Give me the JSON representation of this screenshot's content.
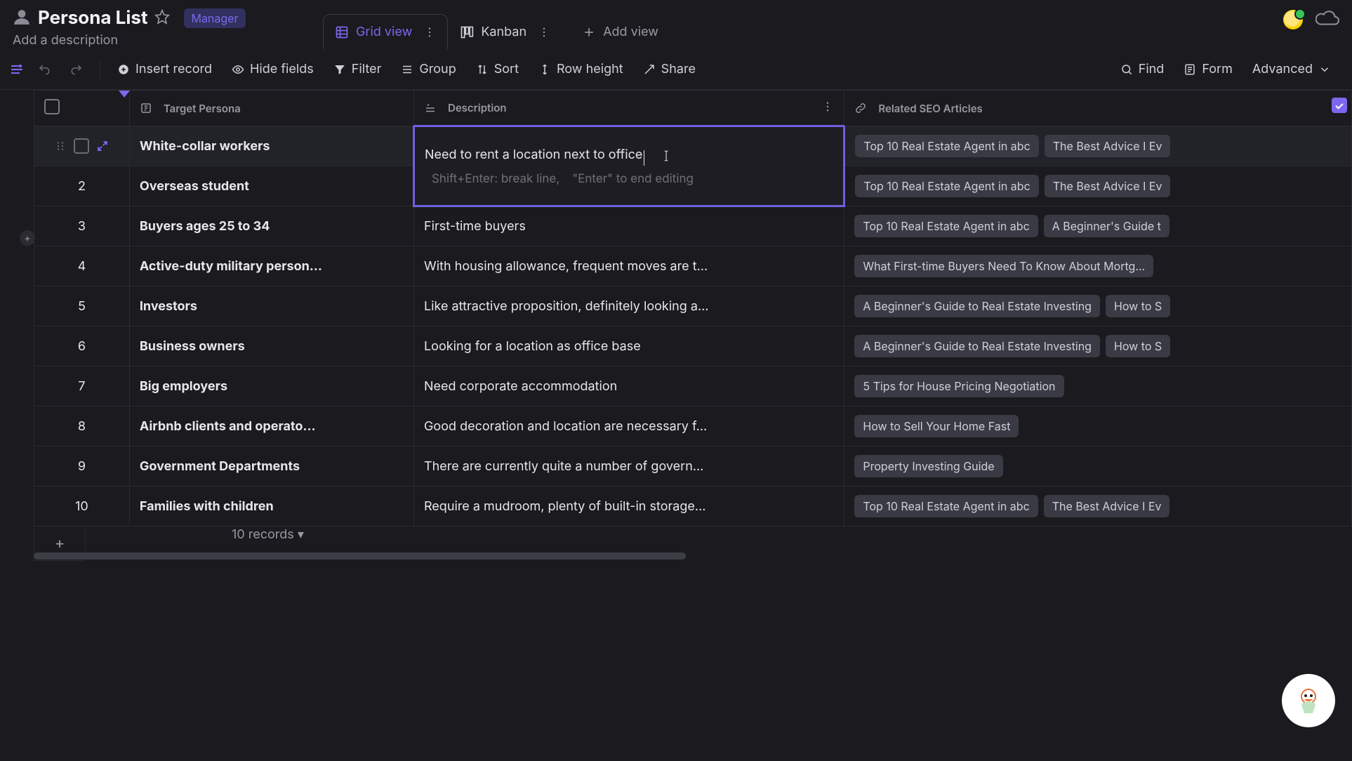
{
  "header": {
    "title": "Persona List",
    "badge": "Manager",
    "desc_placeholder": "Add a description"
  },
  "tabs": {
    "grid": "Grid view",
    "kanban": "Kanban",
    "add_view": "Add view"
  },
  "toolbar": {
    "insert": "Insert record",
    "hide": "Hide fields",
    "filter": "Filter",
    "group": "Group",
    "sort": "Sort",
    "row_height": "Row height",
    "share": "Share",
    "find": "Find",
    "form": "Form",
    "advanced": "Advanced"
  },
  "columns": {
    "persona": "Target Persona",
    "description": "Description",
    "related": "Related SEO Articles"
  },
  "editing": {
    "text": "Need to rent a location next to office",
    "hint1": "Shift+Enter: break line,",
    "hint2": "\"Enter\" to end editing"
  },
  "rows": [
    {
      "persona": "White-collar workers",
      "description": "Need to rent a location next to office",
      "tags": [
        "Top 10 Real Estate Agent in abc",
        "The Best Advice I Ev"
      ]
    },
    {
      "persona": "Overseas student",
      "description": "",
      "tags": [
        "Top 10 Real Estate Agent in abc",
        "The Best Advice I Ev"
      ]
    },
    {
      "persona": "Buyers ages 25 to 34",
      "description": "First-time buyers",
      "tags": [
        "Top 10 Real Estate Agent in abc",
        "A Beginner's Guide t"
      ]
    },
    {
      "persona": "Active-duty military person…",
      "description": "With housing allowance, frequent moves are t…",
      "tags": [
        "What First-time Buyers Need To Know About Mortg…"
      ]
    },
    {
      "persona": "Investors",
      "description": "Like attractive proposition, definitely looking a…",
      "tags": [
        "A Beginner's Guide to Real Estate Investing",
        "How to S"
      ]
    },
    {
      "persona": "Business owners",
      "description": "Looking for a location as office base",
      "tags": [
        "A Beginner's Guide to Real Estate Investing",
        "How to S"
      ]
    },
    {
      "persona": "Big employers",
      "description": "Need corporate accommodation",
      "tags": [
        "5 Tips for House Pricing Negotiation"
      ]
    },
    {
      "persona": "Airbnb clients and operato…",
      "description": "Good decoration and location are necessary f…",
      "tags": [
        "How to Sell Your Home Fast"
      ]
    },
    {
      "persona": "Government Departments",
      "description": "There are currently quite a number of govern…",
      "tags": [
        "Property Investing Guide"
      ]
    },
    {
      "persona": "Families with children",
      "description": "Require a mudroom, plenty of built-in storage…",
      "tags": [
        "Top 10 Real Estate Agent in abc",
        "The Best Advice I Ev"
      ]
    }
  ],
  "footer": {
    "records": "10 records ▾"
  }
}
